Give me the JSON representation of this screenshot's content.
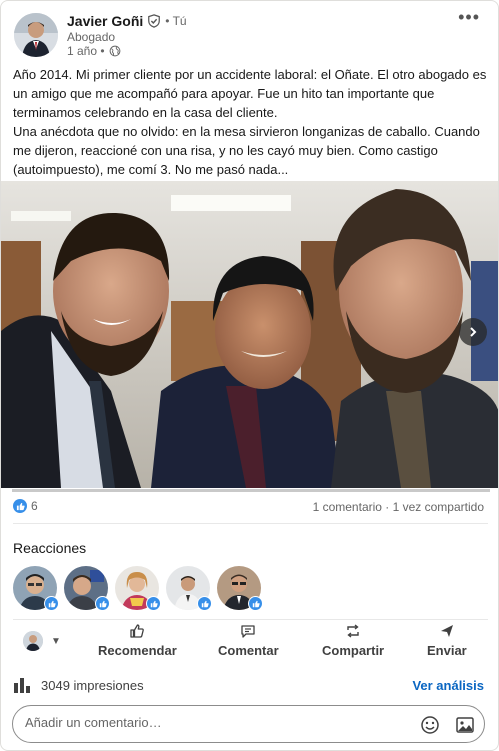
{
  "post": {
    "author": {
      "name": "Javier Goñi",
      "relation": "• Tú",
      "headline": "Abogado",
      "age": "1 año •"
    },
    "text": [
      "Año 2014. Mi primer cliente por un accidente laboral: el Oñate. El otro abogado es un amigo que me acompañó para apoyar. Fue un hito tan importante que terminamos celebrando en la casa del cliente.",
      "Una anécdota que no olvido: en la mesa sirvieron longanizas de caballo. Cuando me dijeron, reaccioné con una risa, y no les cayó muy bien. Como castigo (autoimpuesto), me comí 3. No me pasó nada..."
    ],
    "icons": {
      "verified": "verified-shield-icon",
      "visibility": "globe-icon",
      "more": "more-options-icon",
      "next": "chevron-right-icon"
    }
  },
  "social": {
    "like_count": "6",
    "comments_shares": "1 comentario · 1 vez compartido"
  },
  "reactions": {
    "title": "Reacciones",
    "reactors_count": 5
  },
  "actions": {
    "recommend": "Recomendar",
    "comment": "Comentar",
    "share": "Compartir",
    "send": "Enviar"
  },
  "analytics": {
    "impressions": "3049 impresiones",
    "link": "Ver análisis"
  },
  "comment_box": {
    "placeholder": "Añadir un comentario…"
  },
  "colors": {
    "accent": "#0a66c2",
    "like": "#378fe9",
    "text": "#191919",
    "muted": "#666666"
  }
}
